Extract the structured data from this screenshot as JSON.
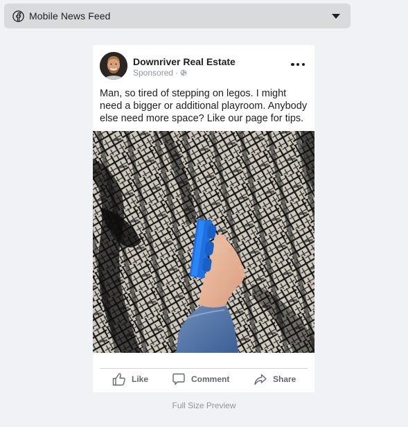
{
  "placement": {
    "icon": "facebook-icon",
    "label": "Mobile News Feed",
    "dropdown_icon": "caret-down-icon"
  },
  "post": {
    "page_name": "Downriver Real Estate",
    "sponsored_label": "Sponsored",
    "separator": "·",
    "privacy_icon": "globe-icon",
    "more_icon": "more-options-icon",
    "text": "Man, so tired of stepping on legos. I might need a bigger or additional playroom. Anybody else need more space? Like our page for tips.",
    "image_alt": "Bare foot stepping next to a blue lego brick on a black and cream patterned rug",
    "actions": [
      {
        "label": "Like",
        "icon": "thumbs-up-icon"
      },
      {
        "label": "Comment",
        "icon": "comment-icon"
      },
      {
        "label": "Share",
        "icon": "share-icon"
      }
    ]
  },
  "preview_caption": "Full Size Preview",
  "colors": {
    "background": "#f0f2f5",
    "dropdown_bg": "#d9dadc",
    "text_primary": "#1c1e21",
    "text_secondary": "#90949c",
    "action_text": "#606770",
    "lego_blue": "#1f6fe0"
  }
}
